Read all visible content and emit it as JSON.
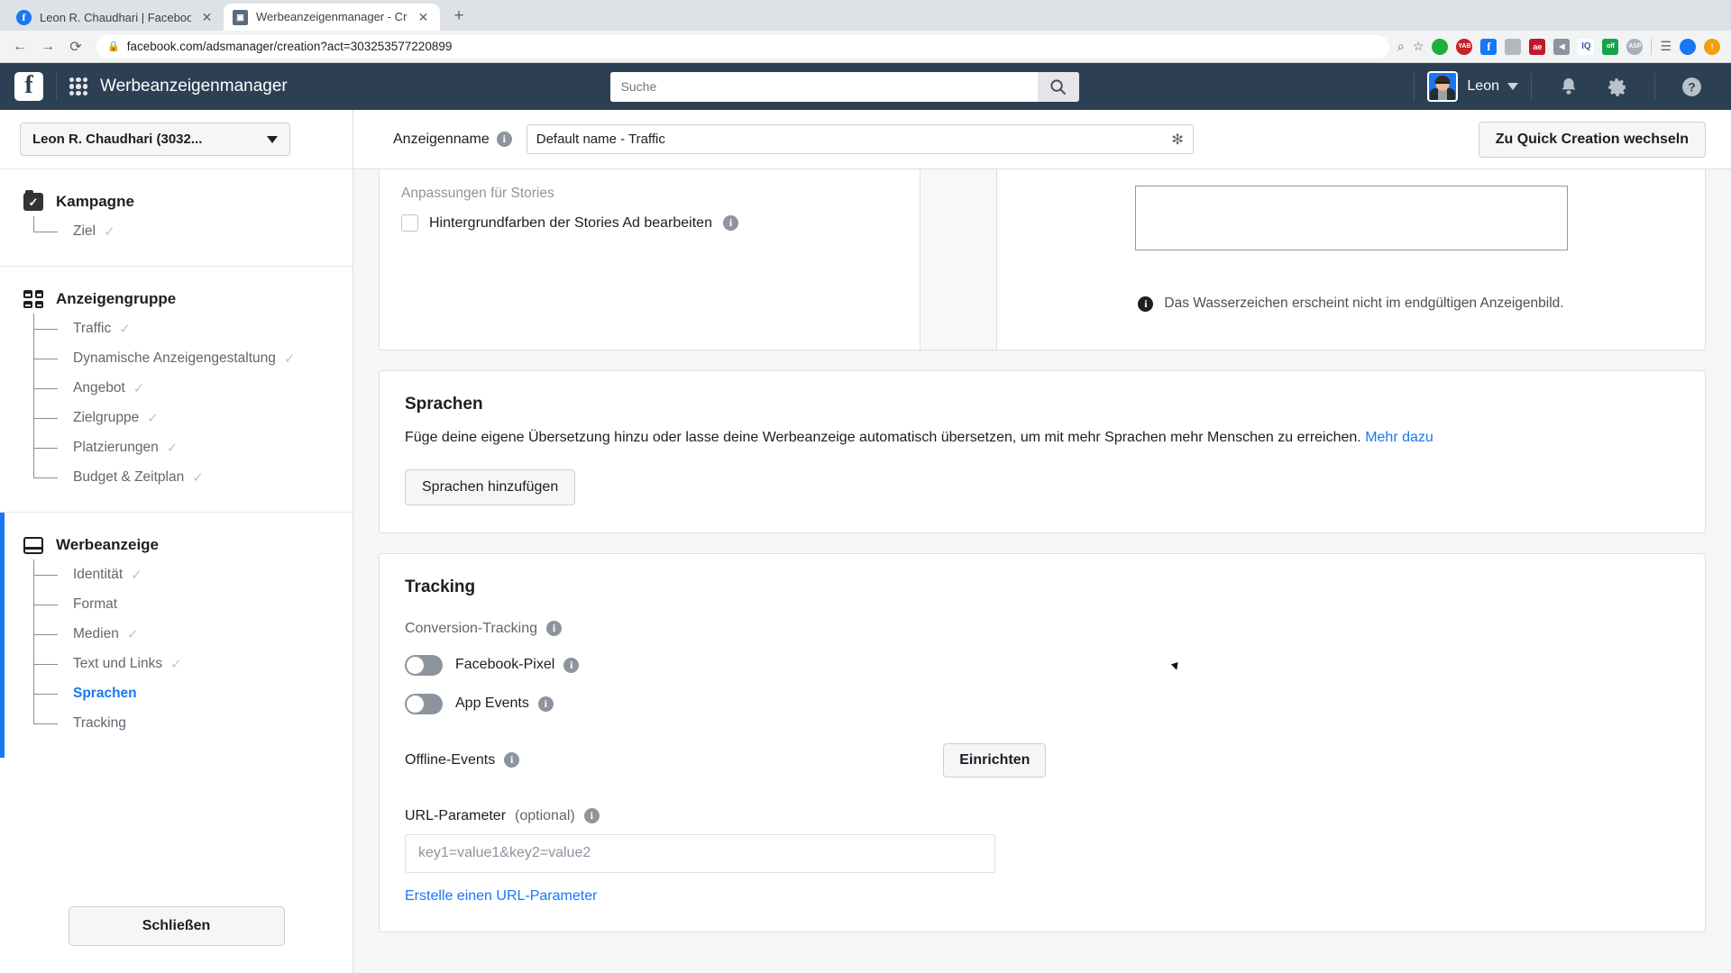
{
  "browser": {
    "tabs": [
      {
        "title": "Leon R. Chaudhari | Facebook",
        "favicon": "facebook-icon",
        "favicon_char": "f",
        "active": false
      },
      {
        "title": "Werbeanzeigenmanager - Cre",
        "favicon": "adsmanager-icon",
        "favicon_char": "▣",
        "active": true
      }
    ],
    "new_tab_label": "+",
    "close_label": "✕",
    "back_label": "←",
    "forward_label": "→",
    "reload_label": "⟳",
    "lock_label": "🔒",
    "url": "facebook.com/adsmanager/creation?act=303253577220899",
    "zoom_icon": "search-icon",
    "star_icon": "bookmark-star-icon",
    "extensions": [
      {
        "name": "green-shield-extension",
        "label": "",
        "color": "#1fae3c",
        "round": true
      },
      {
        "name": "yab-extension",
        "label": "YAB",
        "color": "#c62029",
        "round": true
      },
      {
        "name": "facebook-pixel-helper-extension",
        "label": "f",
        "color": "#1877f2",
        "round": false
      },
      {
        "name": "gray-extension",
        "label": "",
        "color": "#b3b8bf",
        "round": false
      },
      {
        "name": "ae-extension",
        "label": "ae",
        "color": "#c0192b",
        "round": false
      },
      {
        "name": "pocket-extension",
        "label": "◀",
        "color": "#8d949e",
        "round": false
      },
      {
        "name": "iq-extension",
        "label": "IQ",
        "color": "#2f5fa0",
        "round": false
      },
      {
        "name": "off-extension",
        "label": "off",
        "color": "#16a34a",
        "round": false
      },
      {
        "name": "asp-extension",
        "label": "ASP",
        "color": "#a9b0b8",
        "round": true
      }
    ],
    "menu_icon": "playlist-icon",
    "profile_icon": "browser-profile-avatar",
    "update_icon": "update-alert-icon"
  },
  "app_header": {
    "logo": "facebook-logo",
    "logo_char": "f",
    "grid_icon": "app-grid-icon",
    "title": "Werbeanzeigenmanager",
    "search": {
      "value": "",
      "placeholder": "Suche",
      "icon": "search-icon"
    },
    "user": {
      "name": "Leon",
      "avatar": "user-avatar",
      "caret": "chevron-down-icon"
    },
    "notifications_icon": "bell-icon",
    "settings_icon": "gear-icon",
    "help_icon": "help-question-icon"
  },
  "sidebar": {
    "account": {
      "label": "Leon R. Chaudhari (3032...",
      "caret": "chevron-down-icon"
    },
    "groups": [
      {
        "icon": "campaign-checkmark-icon",
        "label": "Kampagne",
        "active": false,
        "items": [
          {
            "label": "Ziel",
            "done": true,
            "selected": false
          }
        ]
      },
      {
        "icon": "adset-grid-icon",
        "label": "Anzeigengruppe",
        "active": false,
        "items": [
          {
            "label": "Traffic",
            "done": true,
            "selected": false
          },
          {
            "label": "Dynamische Anzeigengestaltung",
            "done": true,
            "selected": false
          },
          {
            "label": "Angebot",
            "done": true,
            "selected": false
          },
          {
            "label": "Zielgruppe",
            "done": true,
            "selected": false
          },
          {
            "label": "Platzierungen",
            "done": true,
            "selected": false
          },
          {
            "label": "Budget & Zeitplan",
            "done": true,
            "selected": false
          }
        ]
      },
      {
        "icon": "ad-window-icon",
        "label": "Werbeanzeige",
        "active": true,
        "items": [
          {
            "label": "Identität",
            "done": true,
            "selected": false
          },
          {
            "label": "Format",
            "done": false,
            "selected": false
          },
          {
            "label": "Medien",
            "done": true,
            "selected": false
          },
          {
            "label": "Text und Links",
            "done": true,
            "selected": false
          },
          {
            "label": "Sprachen",
            "done": false,
            "selected": true
          },
          {
            "label": "Tracking",
            "done": false,
            "selected": false
          }
        ]
      }
    ],
    "check_glyph": "✓",
    "close_button": "Schließen"
  },
  "main_top": {
    "label": "Anzeigenname",
    "info_icon": "info-icon",
    "name_value": "Default name - Traffic",
    "gear_icon": "gear-icon",
    "quick_creation_button": "Zu Quick Creation wechseln"
  },
  "stories_card": {
    "sub_label": "Anpassungen für Stories",
    "checkbox_label": "Hintergrundfarben der Stories Ad bearbeiten",
    "checkbox_checked": false,
    "info_icon": "info-icon",
    "watermark_note": "Das Wasserzeichen erscheint nicht im endgültigen Anzeigenbild.",
    "watermark_info_icon": "info-icon"
  },
  "languages_card": {
    "title": "Sprachen",
    "description": "Füge deine eigene Übersetzung hinzu oder lasse deine Werbeanzeige automatisch übersetzen, um mit mehr Sprachen mehr Menschen zu erreichen.",
    "link": "Mehr dazu",
    "button": "Sprachen hinzufügen"
  },
  "tracking_card": {
    "title": "Tracking",
    "conversion_label": "Conversion-Tracking",
    "conversion_info_icon": "info-icon",
    "toggles": [
      {
        "label": "Facebook-Pixel",
        "on": false,
        "info_icon": "info-icon"
      },
      {
        "label": "App Events",
        "on": false,
        "info_icon": "info-icon"
      }
    ],
    "offline_label": "Offline-Events",
    "offline_info_icon": "info-icon",
    "offline_button": "Einrichten",
    "url_param_label": "URL-Parameter",
    "url_param_optional": "(optional)",
    "url_param_info_icon": "info-icon",
    "url_param_value": "",
    "url_param_placeholder": "key1=value1&key2=value2",
    "url_param_link": "Erstelle einen URL-Parameter"
  },
  "colors": {
    "header_bg": "#2d3f52",
    "accent_blue": "#1877f2",
    "page_bg": "#f5f6f7",
    "border": "#dddfe2"
  }
}
